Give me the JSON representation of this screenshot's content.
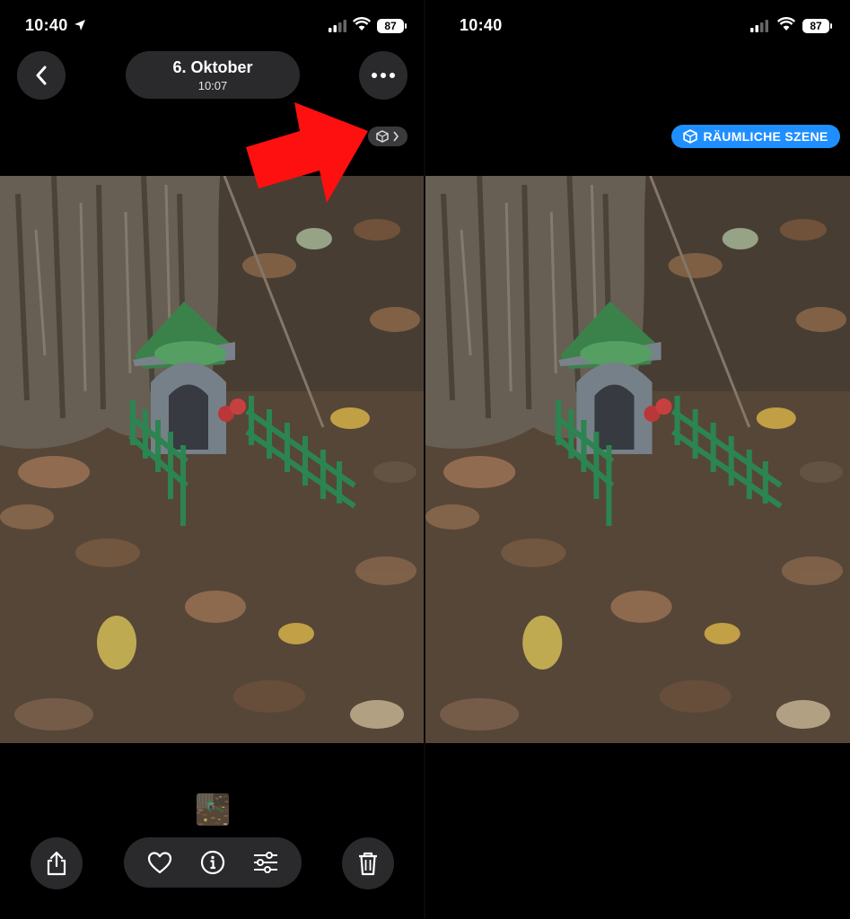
{
  "status": {
    "time": "10:40",
    "battery": "87"
  },
  "header": {
    "date": "6. Oktober",
    "time": "10:07"
  },
  "badge": {
    "spatial_scene_label": "RÄUMLICHE SZENE"
  },
  "icons": {
    "back": "chevron-left-icon",
    "more": "ellipsis-icon",
    "spatial": "spatial-cube-icon",
    "share": "share-icon",
    "favorite": "heart-icon",
    "info": "info-icon",
    "adjust": "sliders-icon",
    "delete": "trash-icon"
  },
  "colors": {
    "accent": "#1f8fff",
    "annotation_arrow": "#ff1010",
    "control_bg": "#2a2a2c"
  }
}
